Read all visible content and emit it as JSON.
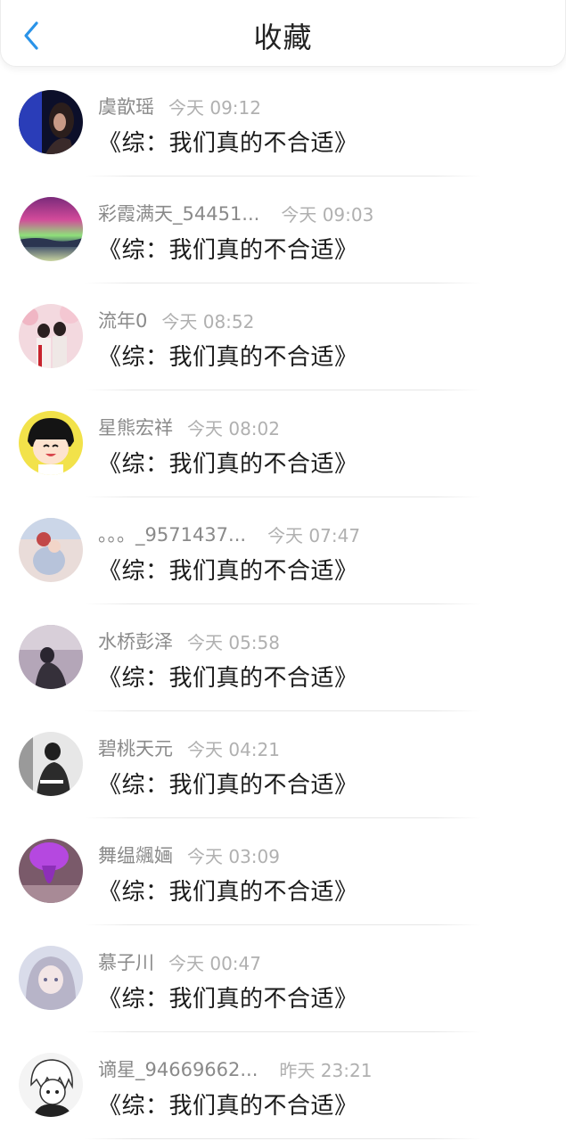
{
  "header": {
    "title": "收藏",
    "back_icon": "chevron-left-icon",
    "accent": "#2a93e8"
  },
  "favorites": [
    {
      "user": "虞歆瑶",
      "time": "今天 09:12",
      "book": "《综：我们真的不合适》",
      "avatar_icon": "avatar-dark-portrait"
    },
    {
      "user": "彩霞满天_54451...",
      "time": "今天 09:03",
      "book": "《综：我们真的不合适》",
      "avatar_icon": "avatar-aurora"
    },
    {
      "user": "流年0",
      "time": "今天 08:52",
      "book": "《综：我们真的不合适》",
      "avatar_icon": "avatar-costume-couple"
    },
    {
      "user": "星熊宏祥",
      "time": "今天 08:02",
      "book": "《综：我们真的不合适》",
      "avatar_icon": "avatar-cartoon-girl"
    },
    {
      "user": "。。。_9571437...",
      "time": "今天 07:47",
      "book": "《综：我们真的不合适》",
      "avatar_icon": "avatar-doll"
    },
    {
      "user": "水桥彭泽",
      "time": "今天 05:58",
      "book": "《综：我们真的不合适》",
      "avatar_icon": "avatar-silhouette"
    },
    {
      "user": "碧桃天元",
      "time": "今天 04:21",
      "book": "《综：我们真的不合适》",
      "avatar_icon": "avatar-man-photo"
    },
    {
      "user": "舞缊飊婳",
      "time": "今天 03:09",
      "book": "《综：我们真的不合适》",
      "avatar_icon": "avatar-purple-abstract"
    },
    {
      "user": "慕子川",
      "time": "今天 00:47",
      "book": "《综：我们真的不合适》",
      "avatar_icon": "avatar-anime-girl"
    },
    {
      "user": "谪星_94669662...",
      "time": "昨天 23:21",
      "book": "《综：我们真的不合适》",
      "avatar_icon": "avatar-manga-sketch"
    }
  ]
}
